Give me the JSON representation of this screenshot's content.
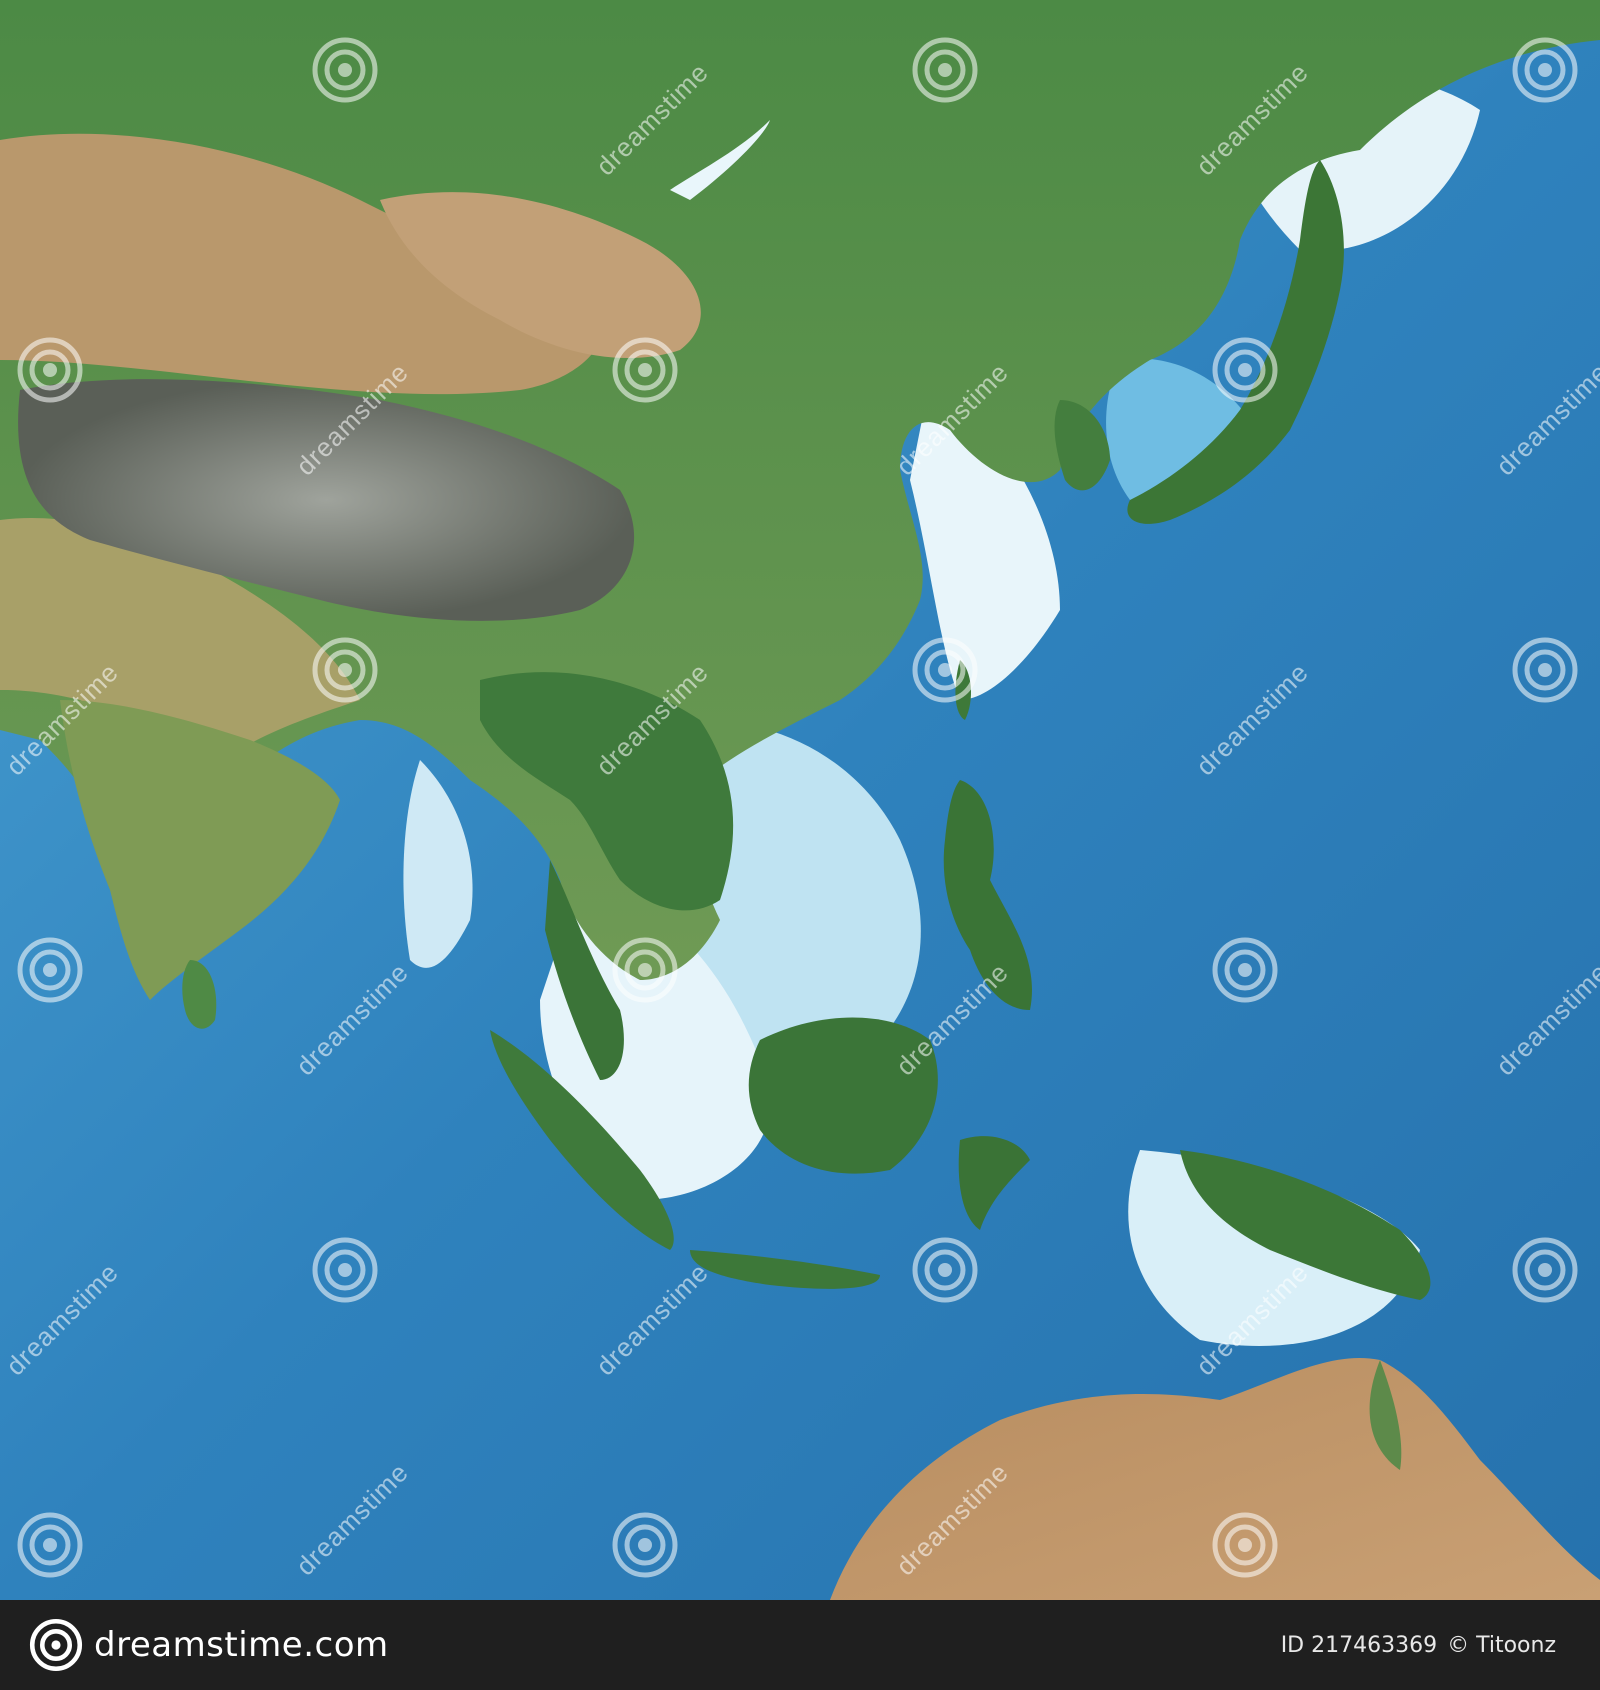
{
  "watermark": {
    "brand_word": "dreamstime",
    "tile_text": "dreamstime"
  },
  "footer": {
    "logo_text": "dreamstime.com",
    "image_id": "ID 217463369",
    "credit": "© Titoonz"
  },
  "colors": {
    "ocean_deep": "#2f7fb8",
    "ocean_shallow": "#8fd3ef",
    "shelf_white": "#e9f6fb",
    "land_green": "#3e7a3a",
    "land_desert": "#b7966a",
    "mountain_gray": "#8a8c86",
    "footer_bg": "#1f1f1f"
  }
}
